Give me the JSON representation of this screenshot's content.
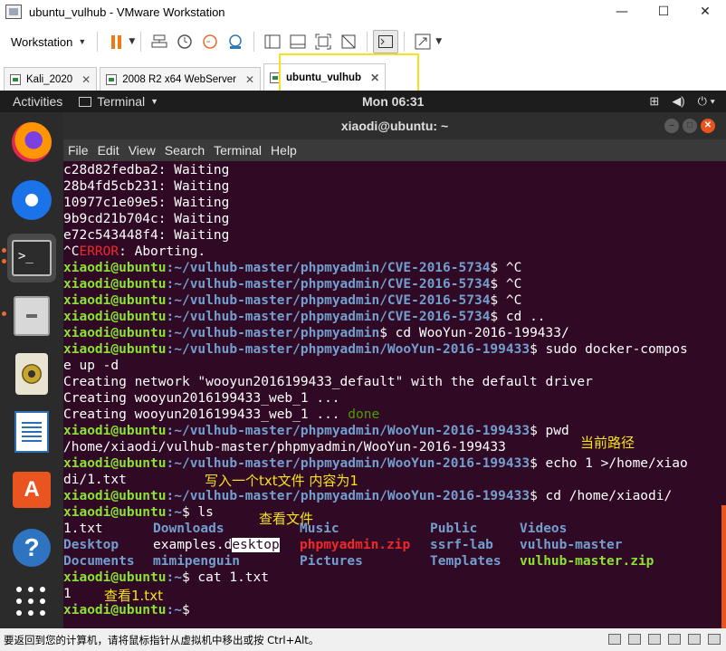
{
  "window": {
    "title": "ubuntu_vulhub - VMware Workstation",
    "minimize": "—",
    "maximize": "☐",
    "close": "✕"
  },
  "toolbar": {
    "workstation_label": "Workstation"
  },
  "tabs": [
    {
      "label": "Kali_2020"
    },
    {
      "label": "2008 R2 x64 WebServer"
    },
    {
      "label": "ubuntu_vulhub"
    }
  ],
  "ubuntu": {
    "activities": "Activities",
    "app_menu": "Terminal",
    "clock": "Mon 06:31"
  },
  "terminal": {
    "title": "xiaodi@ubuntu: ~",
    "menu": [
      "File",
      "Edit",
      "View",
      "Search",
      "Terminal",
      "Help"
    ],
    "prompt_user": "xiaodi@ubuntu",
    "lines": {
      "l1": "c28d82fedba2: Waiting",
      "l2": "28b4fd5cb231: Waiting",
      "l3": "10977c1e09e5: Waiting",
      "l4": "9b9cd21b704c: Waiting",
      "l5": "e72c543448f4: Waiting",
      "l6_a": "^C",
      "l6_b": "ERROR",
      "l6_c": ": Aborting.",
      "path_cve": ":~/vulhub-master/phpmyadmin/CVE-2016-5734",
      "path_pma": ":~/vulhub-master/phpmyadmin",
      "path_woo": ":~/vulhub-master/phpmyadmin/WooYun-2016-199433",
      "path_home": ":~",
      "cmd_ctrlc": "$ ^C",
      "cmd_cd_up": "$ cd ..",
      "cmd_cd_woo": "$ cd WooYun-2016-199433/",
      "cmd_compose": "$ sudo docker-compos",
      "compose_wrap": "e up -d",
      "net_create": "Creating network \"wooyun2016199433_default\" with the default driver",
      "web_create": "Creating wooyun2016199433_web_1 ... ",
      "web_done_a": "Creating wooyun2016199433_web_1 ... ",
      "web_done_b": "done",
      "cmd_pwd": "$ pwd",
      "pwd_out": "/home/xiaodi/vulhub-master/phpmyadmin/WooYun-2016-199433",
      "cmd_echo": "$ echo 1 >/home/xiao",
      "echo_wrap": "di/1.txt",
      "cmd_cd_home": "$ cd /home/xiaodi/",
      "cmd_ls": "$ ls",
      "cmd_cat": "$ cat 1.txt",
      "cat_out": "1",
      "final_prompt": "$ "
    },
    "ls_output": {
      "c1": [
        "1.txt",
        "Desktop",
        "Documents"
      ],
      "c2": [
        "Downloads",
        "examples.d",
        "esktop",
        "mimipenguin"
      ],
      "c3": [
        "Music",
        "phpmyadmin.zip",
        "Pictures"
      ],
      "c4": [
        "Public",
        "ssrf-lab",
        "Templates"
      ],
      "c5": [
        "Videos",
        "vulhub-master",
        "vulhub-master.zip"
      ]
    }
  },
  "annotations": {
    "current_path": "当前路径",
    "write_file": "写入一个txt文件 内容为1",
    "view_files": "查看文件",
    "view_txt": "查看1.txt"
  },
  "statusbar": {
    "message": "要返回到您的计算机，请将鼠标指针从虚拟机中移出或按 Ctrl+Alt。"
  },
  "colors": {
    "terminal_bg": "#300a24",
    "prompt_green": "#8ae234",
    "path_blue": "#729fcf",
    "error_red": "#ef2929",
    "annotation_yellow": "#f4e21a",
    "ubuntu_orange": "#e95420"
  },
  "icons": {
    "dock": [
      "firefox-icon",
      "thunderbird-icon",
      "terminal-icon",
      "files-icon",
      "rhythmbox-icon",
      "libreoffice-writer-icon",
      "ubuntu-software-icon",
      "help-icon",
      "show-apps-icon"
    ]
  }
}
